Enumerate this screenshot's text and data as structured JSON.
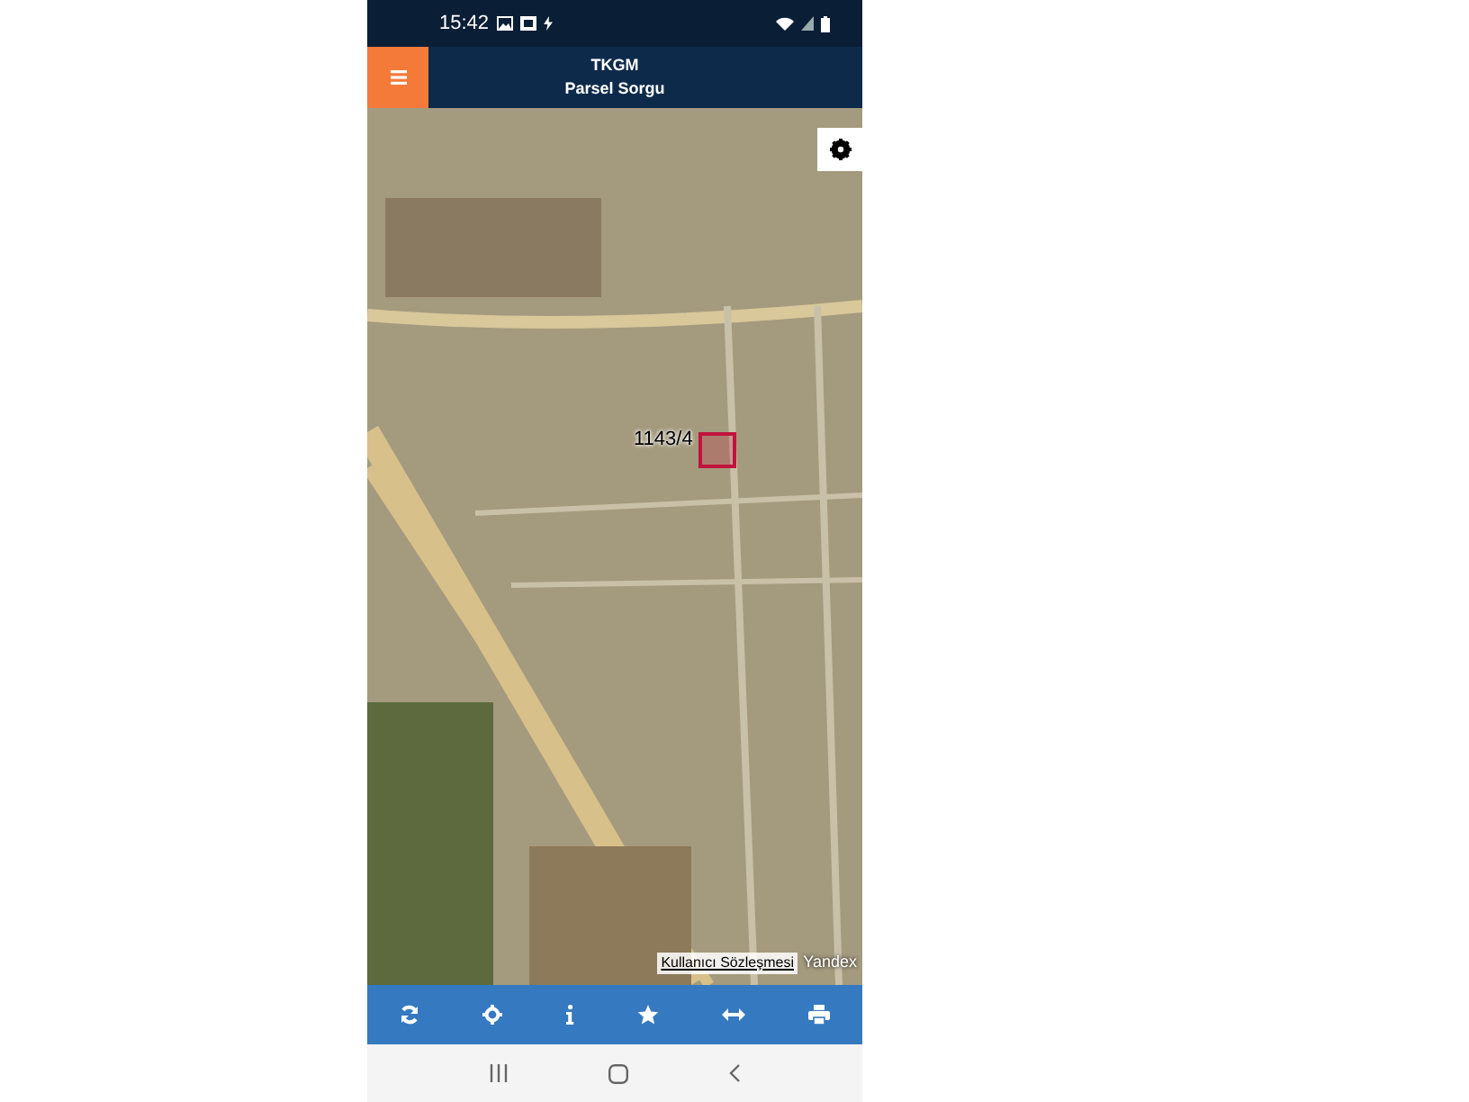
{
  "status_bar": {
    "time": "15:42"
  },
  "header": {
    "title": "TKGM",
    "subtitle": "Parsel Sorgu"
  },
  "map": {
    "parcel_label": "1143/4",
    "attribution_link": "Kullanıcı Sözleşmesi",
    "provider_logo": "Yandex"
  }
}
